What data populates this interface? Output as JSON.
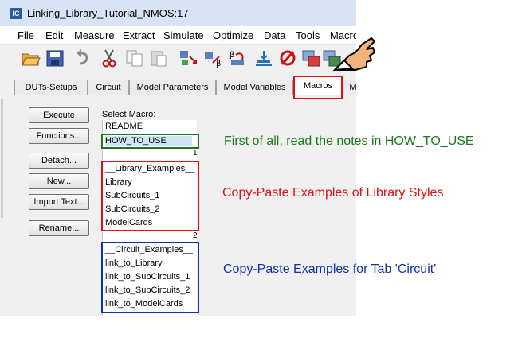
{
  "window": {
    "title": "Linking_Library_Tutorial_NMOS:17",
    "app_icon": "IC"
  },
  "menu": [
    "File",
    "Edit",
    "Measure",
    "Extract",
    "Simulate",
    "Optimize",
    "Data",
    "Tools",
    "Macro"
  ],
  "toolbar_icons": [
    "open-folder-icon",
    "save-icon",
    "undo-icon",
    "cut-icon",
    "copy-icon",
    "paste-icon",
    "tool-a-icon",
    "tool-b-icon",
    "tool-c-icon",
    "tool-d-icon",
    "null-icon",
    "tool-e-icon",
    "tool-f-icon",
    "pointing-hand-icon"
  ],
  "tabs": [
    "DUTs-Setups",
    "Circuit",
    "Model Parameters",
    "Model Variables",
    "Macros",
    "M"
  ],
  "active_tab": "Macros",
  "buttons": [
    "Execute",
    "Functions...",
    "Detach...",
    "New...",
    "Import Text...",
    "Rename..."
  ],
  "select_label": "Select Macro:",
  "macros": [
    "README",
    "HOW_TO_USE",
    "__Library_Examples__",
    "Library",
    "SubCircuits_1",
    "SubCircuits_2",
    "ModelCards",
    "__Circuit_Examples__",
    "link_to_Library",
    "link_to_SubCircuits_1",
    "link_to_SubCircuits_2",
    "link_to_ModelCards"
  ],
  "group_numbers": [
    "1",
    "2"
  ],
  "annotations": {
    "first": "First of all, read the notes in HOW_TO_USE",
    "library": "Copy-Paste Examples of Library Styles",
    "circuit": "Copy-Paste Examples for Tab 'Circuit'"
  },
  "colors": {
    "green": "#1a7a1a",
    "red": "#e01010",
    "blue": "#1030b0"
  }
}
